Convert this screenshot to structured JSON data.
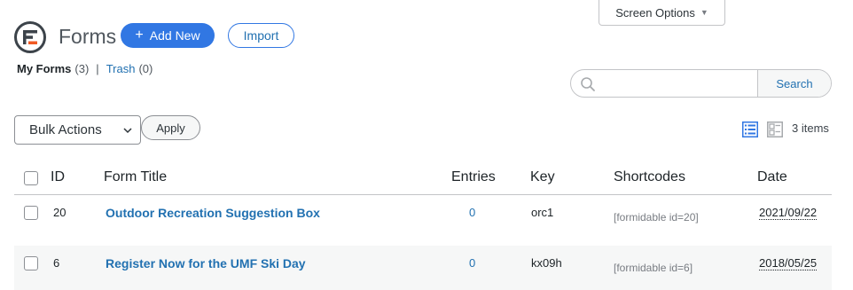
{
  "screen_options": {
    "label": "Screen Options"
  },
  "header": {
    "title": "Forms",
    "add_new_label": "Add New",
    "add_new_symbol": "+",
    "import_label": "Import"
  },
  "views": {
    "my_forms_label": "My Forms",
    "my_forms_count": "(3)",
    "separator": "|",
    "trash_label": "Trash",
    "trash_count": "(0)"
  },
  "search": {
    "value": "",
    "placeholder": "",
    "button_label": "Search"
  },
  "bulk": {
    "selected": "Bulk Actions",
    "apply_label": "Apply"
  },
  "pagination": {
    "items_count": "3 items"
  },
  "table": {
    "columns": {
      "id": "ID",
      "title": "Form Title",
      "entries": "Entries",
      "key": "Key",
      "shortcodes": "Shortcodes",
      "date": "Date"
    },
    "rows": [
      {
        "id": "20",
        "title": "Outdoor Recreation Suggestion Box",
        "entries": "0",
        "key": "orc1",
        "shortcode": "[formidable id=20]",
        "date": "2021/09/22"
      },
      {
        "id": "6",
        "title": "Register Now for the UMF Ski Day",
        "entries": "0",
        "key": "kx09h",
        "shortcode": "[formidable id=6]",
        "date": "2018/05/25"
      }
    ]
  },
  "colors": {
    "accent": "#3177e3",
    "link": "#2271b1",
    "logo_accent": "#f05a24"
  },
  "icons": {
    "logo": "formidable-logo-icon",
    "search": "search-icon",
    "dropdown": "chevron-down-icon",
    "list_view": "list-view-icon",
    "excerpt_view": "excerpt-view-icon"
  }
}
